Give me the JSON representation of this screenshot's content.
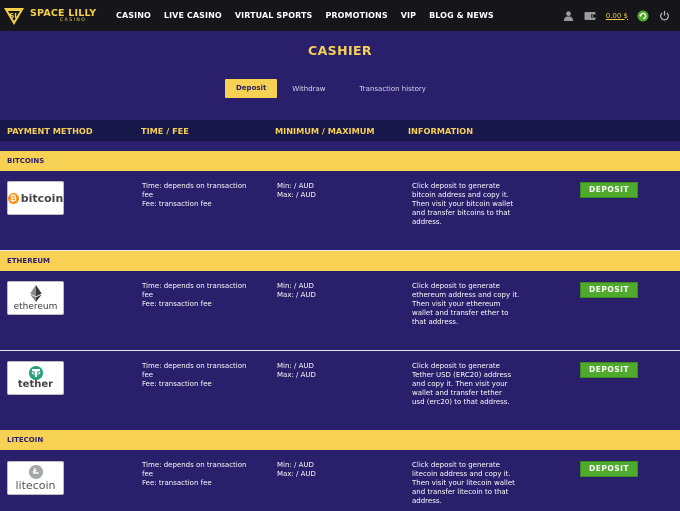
{
  "brand": {
    "name": "SPACE LILLY",
    "sub": "CASINO"
  },
  "nav": [
    "CASINO",
    "LIVE CASINO",
    "VIRTUAL SPORTS",
    "PROMOTIONS",
    "VIP",
    "BLOG & NEWS"
  ],
  "header_right": {
    "balance": "0.00 $"
  },
  "page_title": "CASHIER",
  "tabs": {
    "deposit": "Deposit",
    "withdraw": "Withdraw",
    "history": "Transaction history"
  },
  "columns": [
    "PAYMENT METHOD",
    "TIME / FEE",
    "MINIMUM / MAXIMUM",
    "INFORMATION"
  ],
  "methods": [
    {
      "band": "BITCOINS",
      "logo_text": "bitcoin",
      "time": [
        "Time: depends on transaction",
        "fee",
        "Fee: transaction fee"
      ],
      "limits": [
        "Min: / AUD",
        "Max: / AUD"
      ],
      "info": [
        "Click deposit to generate",
        "bitcoin address and copy it.",
        "Then visit your bitcoin wallet",
        "and transfer bitcoins to that",
        "address."
      ],
      "button": "DEPOSIT"
    },
    {
      "band": "ETHEREUM",
      "logo_text": "ethereum",
      "time": [
        "Time: depends on transaction",
        "fee",
        "Fee: transaction fee"
      ],
      "limits": [
        "Min: / AUD",
        "Max: / AUD"
      ],
      "info": [
        "Click deposit to generate",
        "ethereum address and copy it.",
        "Then visit your ethereum",
        "wallet and transfer ether to",
        "that address."
      ],
      "button": "DEPOSIT"
    },
    {
      "band": "",
      "logo_text": "tether",
      "time": [
        "Time: depends on transaction",
        "fee",
        "Fee: transaction fee"
      ],
      "limits": [
        "Min: / AUD",
        "Max: / AUD"
      ],
      "info": [
        "Click deposit to generate",
        "Tether USD (ERC20) address",
        "and copy it. Then visit your",
        "wallet and transfer tether",
        "usd (erc20) to that address."
      ],
      "button": "DEPOSIT"
    },
    {
      "band": "LITECOIN",
      "logo_text": "litecoin",
      "time": [
        "Time: depends on transaction",
        "fee",
        "Fee: transaction fee"
      ],
      "limits": [
        "Min: / AUD",
        "Max: / AUD"
      ],
      "info": [
        "Click deposit to generate",
        "litecoin address and copy it.",
        "Then visit your litecoin wallet",
        "and transfer litecoin to that",
        "address."
      ],
      "button": "DEPOSIT"
    }
  ],
  "colors": {
    "accent": "#f7d154",
    "background": "#2a1f6b",
    "button": "#4faa2e",
    "topbar": "#16161a"
  }
}
